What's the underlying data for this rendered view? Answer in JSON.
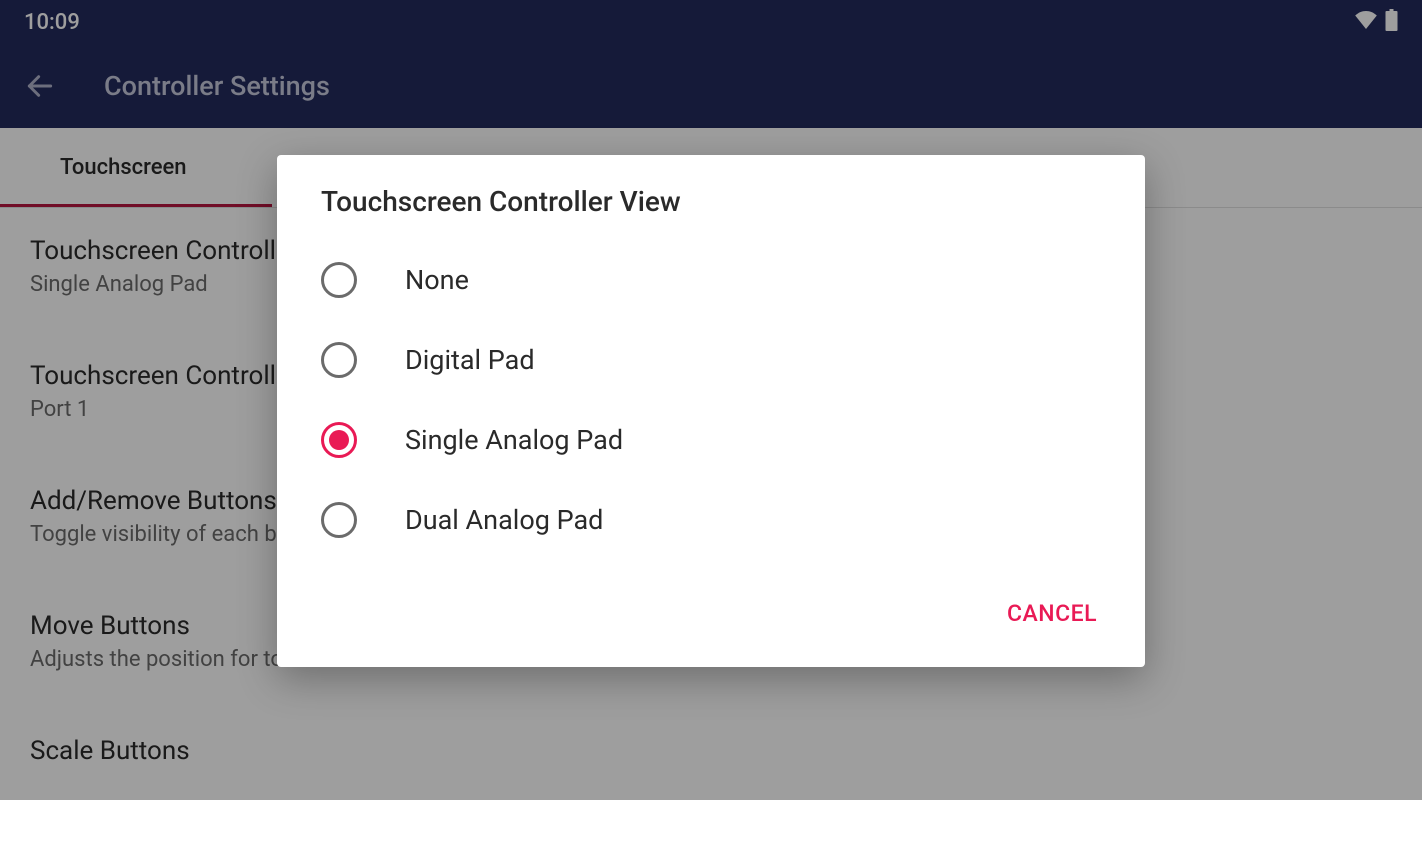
{
  "status": {
    "time": "10:09"
  },
  "appbar": {
    "title": "Controller Settings"
  },
  "tabs": {
    "active": "Touchscreen"
  },
  "settings": [
    {
      "title": "Touchscreen Controller View",
      "subtitle": "Single Analog Pad"
    },
    {
      "title": "Touchscreen Controller Port",
      "subtitle": "Port 1"
    },
    {
      "title": "Add/Remove Buttons",
      "subtitle": "Toggle visibility of each button."
    },
    {
      "title": "Move Buttons",
      "subtitle": "Adjusts the position for touchscreen buttons."
    },
    {
      "title": "Scale Buttons",
      "subtitle": ""
    }
  ],
  "dialog": {
    "title": "Touchscreen Controller View",
    "options": [
      {
        "label": "None",
        "selected": false
      },
      {
        "label": "Digital Pad",
        "selected": false
      },
      {
        "label": "Single Analog Pad",
        "selected": true
      },
      {
        "label": "Dual Analog Pad",
        "selected": false
      }
    ],
    "cancel": "CANCEL"
  }
}
